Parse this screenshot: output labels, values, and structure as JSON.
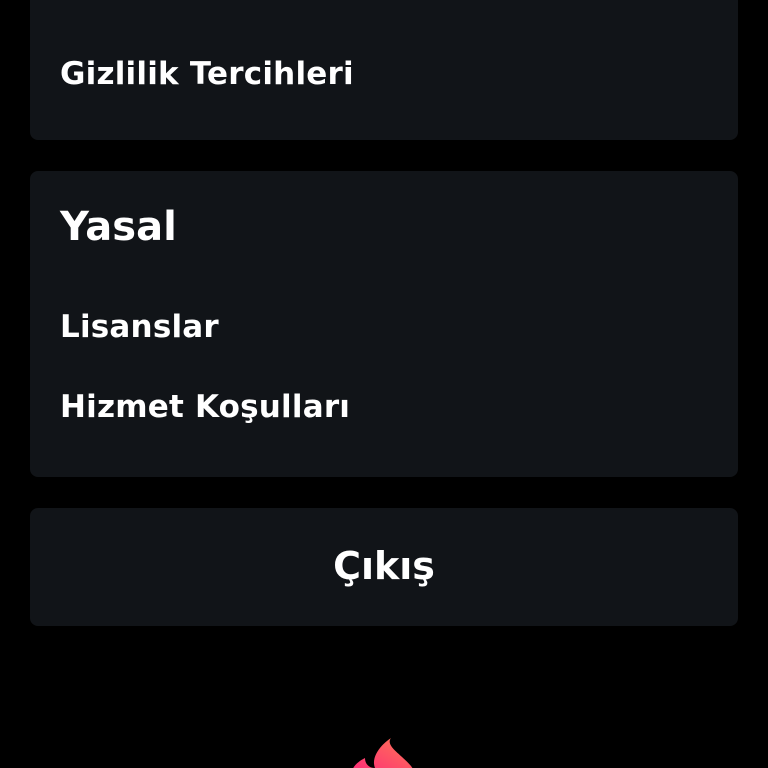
{
  "settings": {
    "privacy_preferences_label": "Gizlilik Tercihleri",
    "legal": {
      "title": "Yasal",
      "items": [
        {
          "label": "Lisanslar"
        },
        {
          "label": "Hizmet Koşulları"
        }
      ]
    },
    "logout_label": "Çıkış"
  },
  "brand": {
    "logo_icon": "flame-icon",
    "accent_color": "#FE5A5A"
  },
  "theme": {
    "background": "#000000",
    "card": "#111418",
    "text": "#FFFFFF"
  }
}
